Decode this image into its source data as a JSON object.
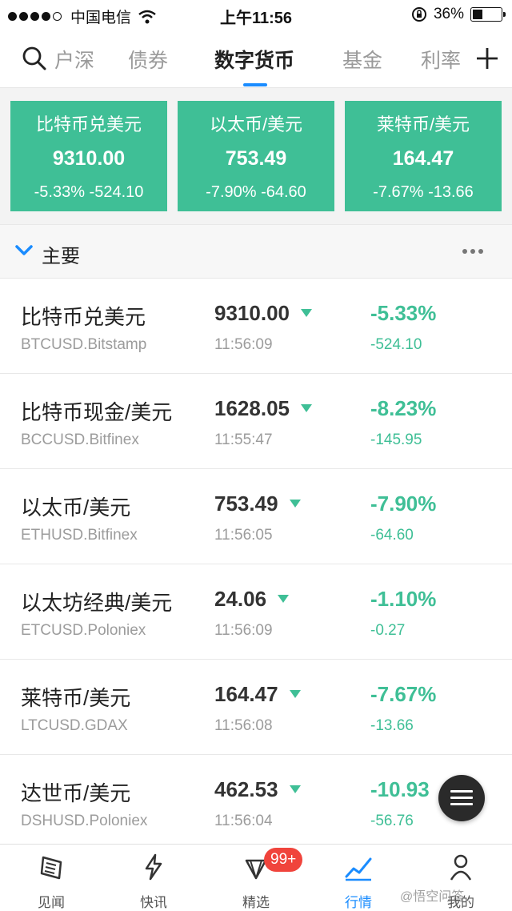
{
  "status": {
    "carrier": "中国电信",
    "time": "上午11:56",
    "battery": "36%",
    "battery_level": 0.36
  },
  "tabs": [
    {
      "label": "户深"
    },
    {
      "label": "债券"
    },
    {
      "label": "数字货币"
    },
    {
      "label": "基金"
    },
    {
      "label": "利率"
    }
  ],
  "cards": [
    {
      "name": "比特币兑美元",
      "price": "9310.00",
      "change": "-5.33% -524.10"
    },
    {
      "name": "以太币/美元",
      "price": "753.49",
      "change": "-7.90% -64.60"
    },
    {
      "name": "莱特币/美元",
      "price": "164.47",
      "change": "-7.67% -13.66"
    }
  ],
  "section": {
    "title": "主要"
  },
  "rows": [
    {
      "name": "比特币兑美元",
      "symbol": "BTCUSD.Bitstamp",
      "price": "9310.00",
      "time": "11:56:09",
      "pct": "-5.33%",
      "abs": "-524.10"
    },
    {
      "name": "比特币现金/美元",
      "symbol": "BCCUSD.Bitfinex",
      "price": "1628.05",
      "time": "11:55:47",
      "pct": "-8.23%",
      "abs": "-145.95"
    },
    {
      "name": "以太币/美元",
      "symbol": "ETHUSD.Bitfinex",
      "price": "753.49",
      "time": "11:56:05",
      "pct": "-7.90%",
      "abs": "-64.60"
    },
    {
      "name": "以太坊经典/美元",
      "symbol": "ETCUSD.Poloniex",
      "price": "24.06",
      "time": "11:56:09",
      "pct": "-1.10%",
      "abs": "-0.27"
    },
    {
      "name": "莱特币/美元",
      "symbol": "LTCUSD.GDAX",
      "price": "164.47",
      "time": "11:56:08",
      "pct": "-7.67%",
      "abs": "-13.66"
    },
    {
      "name": "达世币/美元",
      "symbol": "DSHUSD.Poloniex",
      "price": "462.53",
      "time": "11:56:04",
      "pct": "-10.93",
      "abs": "-56.76"
    }
  ],
  "bottom_nav": [
    {
      "label": "见闻"
    },
    {
      "label": "快讯"
    },
    {
      "label": "精选"
    },
    {
      "label": "行情"
    },
    {
      "label": "我的"
    }
  ],
  "badge": "99+",
  "watermark": "@悟空问答",
  "colors": {
    "up_down_green": "#3fbf96",
    "accent": "#1a8cff",
    "badge": "#f0443c"
  }
}
